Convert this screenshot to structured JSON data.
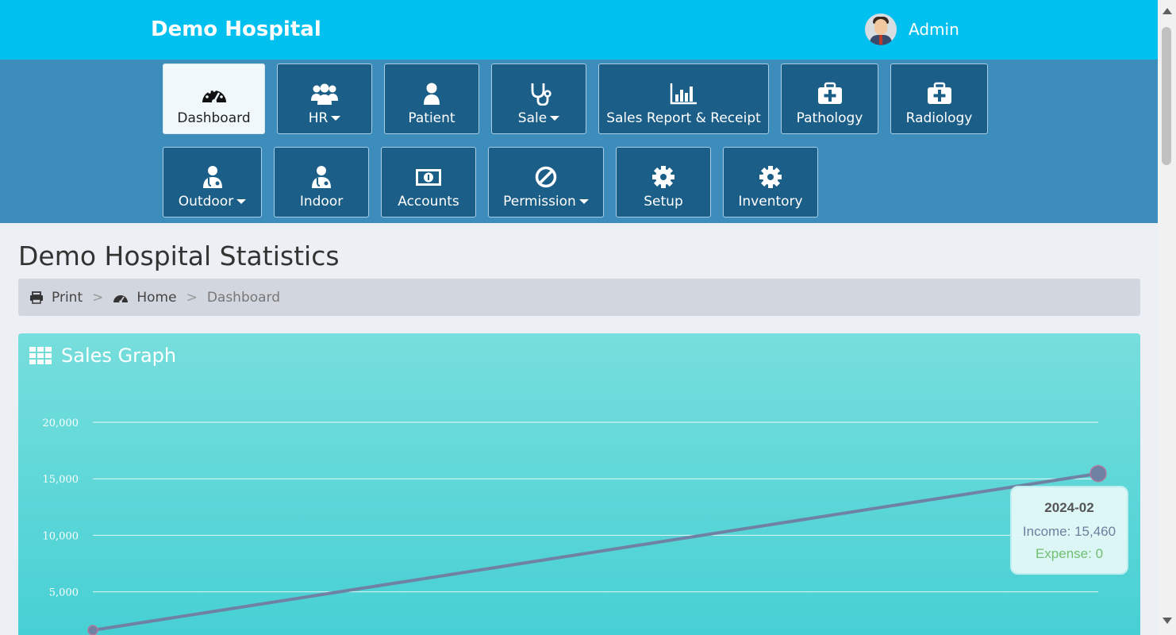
{
  "header": {
    "brand": "Demo Hospital",
    "user": "Admin"
  },
  "nav": [
    {
      "label": "Dashboard",
      "icon": "dashboard-icon",
      "active": true,
      "caret": false
    },
    {
      "label": "HR",
      "icon": "users-icon",
      "caret": true
    },
    {
      "label": "Patient",
      "icon": "user-icon",
      "caret": false
    },
    {
      "label": "Sale",
      "icon": "stethoscope-icon",
      "caret": true
    },
    {
      "label": "Sales Report & Receipt",
      "icon": "bar-chart-icon",
      "caret": false
    },
    {
      "label": "Pathology",
      "icon": "medkit-icon",
      "caret": false
    },
    {
      "label": "Radiology",
      "icon": "medkit-icon",
      "caret": false
    },
    {
      "label": "Outdoor",
      "icon": "doctor-icon",
      "caret": true
    },
    {
      "label": "Indoor",
      "icon": "doctor-icon",
      "caret": false
    },
    {
      "label": "Accounts",
      "icon": "money-icon",
      "caret": false
    },
    {
      "label": "Permission",
      "icon": "ban-icon",
      "caret": true
    },
    {
      "label": "Setup",
      "icon": "gear-icon",
      "caret": false
    },
    {
      "label": "Inventory",
      "icon": "gear-icon",
      "caret": false
    }
  ],
  "page": {
    "title": "Demo Hospital Statistics"
  },
  "breadcrumb": {
    "print": "Print",
    "home": "Home",
    "current": "Dashboard",
    "separator": ">"
  },
  "panel": {
    "title": "Sales Graph"
  },
  "tooltip": {
    "date": "2024-02",
    "income": "Income: 15,460",
    "expense": "Expense: 0"
  },
  "chart_data": {
    "type": "line",
    "y_ticks": [
      "20,000",
      "15,000",
      "10,000",
      "5,000"
    ],
    "ylim": [
      0,
      20000
    ],
    "grid": true,
    "series": [
      {
        "name": "Income",
        "color": "#6f82a4",
        "values": [
          1600,
          15460
        ]
      },
      {
        "name": "Expense",
        "color": "#6fbf6f",
        "values": [
          0,
          0
        ]
      }
    ]
  },
  "colors": {
    "topbar": "#00c0ef",
    "navbar": "#3c8dbc",
    "navbtn": "#1b5e88"
  }
}
